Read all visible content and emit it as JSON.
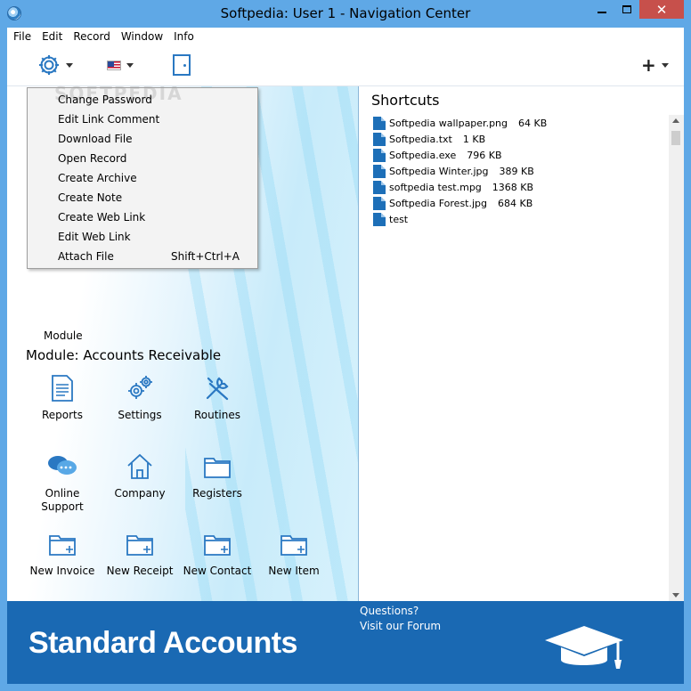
{
  "window": {
    "title": "Softpedia: User 1 - Navigation Center",
    "close_glyph": "✕"
  },
  "menubar": {
    "items": [
      "File",
      "Edit",
      "Record",
      "Window",
      "Info"
    ]
  },
  "toolbar": {
    "settings_icon": "gear-icon",
    "flag_icon": "us-flag-icon",
    "door_icon": "exit-door-icon",
    "add_glyph": "+"
  },
  "watermark": "SOFTPEDIA",
  "dropdown": {
    "items": [
      {
        "label": "Change Password",
        "shortcut": ""
      },
      {
        "label": "Edit Link Comment",
        "shortcut": ""
      },
      {
        "label": "Download File",
        "shortcut": ""
      },
      {
        "label": "Open Record",
        "shortcut": ""
      },
      {
        "label": "Create Archive",
        "shortcut": ""
      },
      {
        "label": "Create Note",
        "shortcut": ""
      },
      {
        "label": "Create Web Link",
        "shortcut": ""
      },
      {
        "label": "Edit Web Link",
        "shortcut": ""
      },
      {
        "label": "Attach File",
        "shortcut": "Shift+Ctrl+A"
      }
    ]
  },
  "left": {
    "module_partial": "Module",
    "module_header": "Module:  Accounts Receivable",
    "tiles": [
      {
        "label": "Reports",
        "icon": "reports-icon"
      },
      {
        "label": "Settings",
        "icon": "settings-icon"
      },
      {
        "label": "Routines",
        "icon": "routines-icon"
      },
      {
        "label": "Online\nSupport",
        "line1": "Online",
        "line2": "Support",
        "icon": "chat-icon"
      },
      {
        "label": "Company",
        "icon": "home-icon"
      },
      {
        "label": "Registers",
        "icon": "folder-icon"
      },
      {
        "label": "New Invoice",
        "icon": "new-folder-icon"
      },
      {
        "label": "New Receipt",
        "icon": "new-folder-icon"
      },
      {
        "label": "New Contact",
        "icon": "new-folder-icon"
      },
      {
        "label": "New Item",
        "icon": "new-folder-icon"
      }
    ]
  },
  "shortcuts": {
    "title": "Shortcuts",
    "files": [
      {
        "name": "Softpedia wallpaper.png",
        "size": "64 KB"
      },
      {
        "name": "Softpedia.txt",
        "size": "1 KB"
      },
      {
        "name": "Softpedia.exe",
        "size": "796 KB"
      },
      {
        "name": "Softpedia Winter.jpg",
        "size": "389 KB"
      },
      {
        "name": "softpedia test.mpg",
        "size": "1368 KB"
      },
      {
        "name": "Softpedia Forest.jpg",
        "size": "684 KB"
      },
      {
        "name": "test",
        "size": ""
      }
    ]
  },
  "footer": {
    "brand": "Standard Accounts",
    "questions": "Questions?",
    "forum_link": "Visit our Forum",
    "icon": "graduation-cap-icon"
  },
  "colors": {
    "titlebar": "#5fa8e6",
    "footer": "#1a69b3",
    "accent": "#1d6fb8",
    "close": "#c7504b"
  }
}
